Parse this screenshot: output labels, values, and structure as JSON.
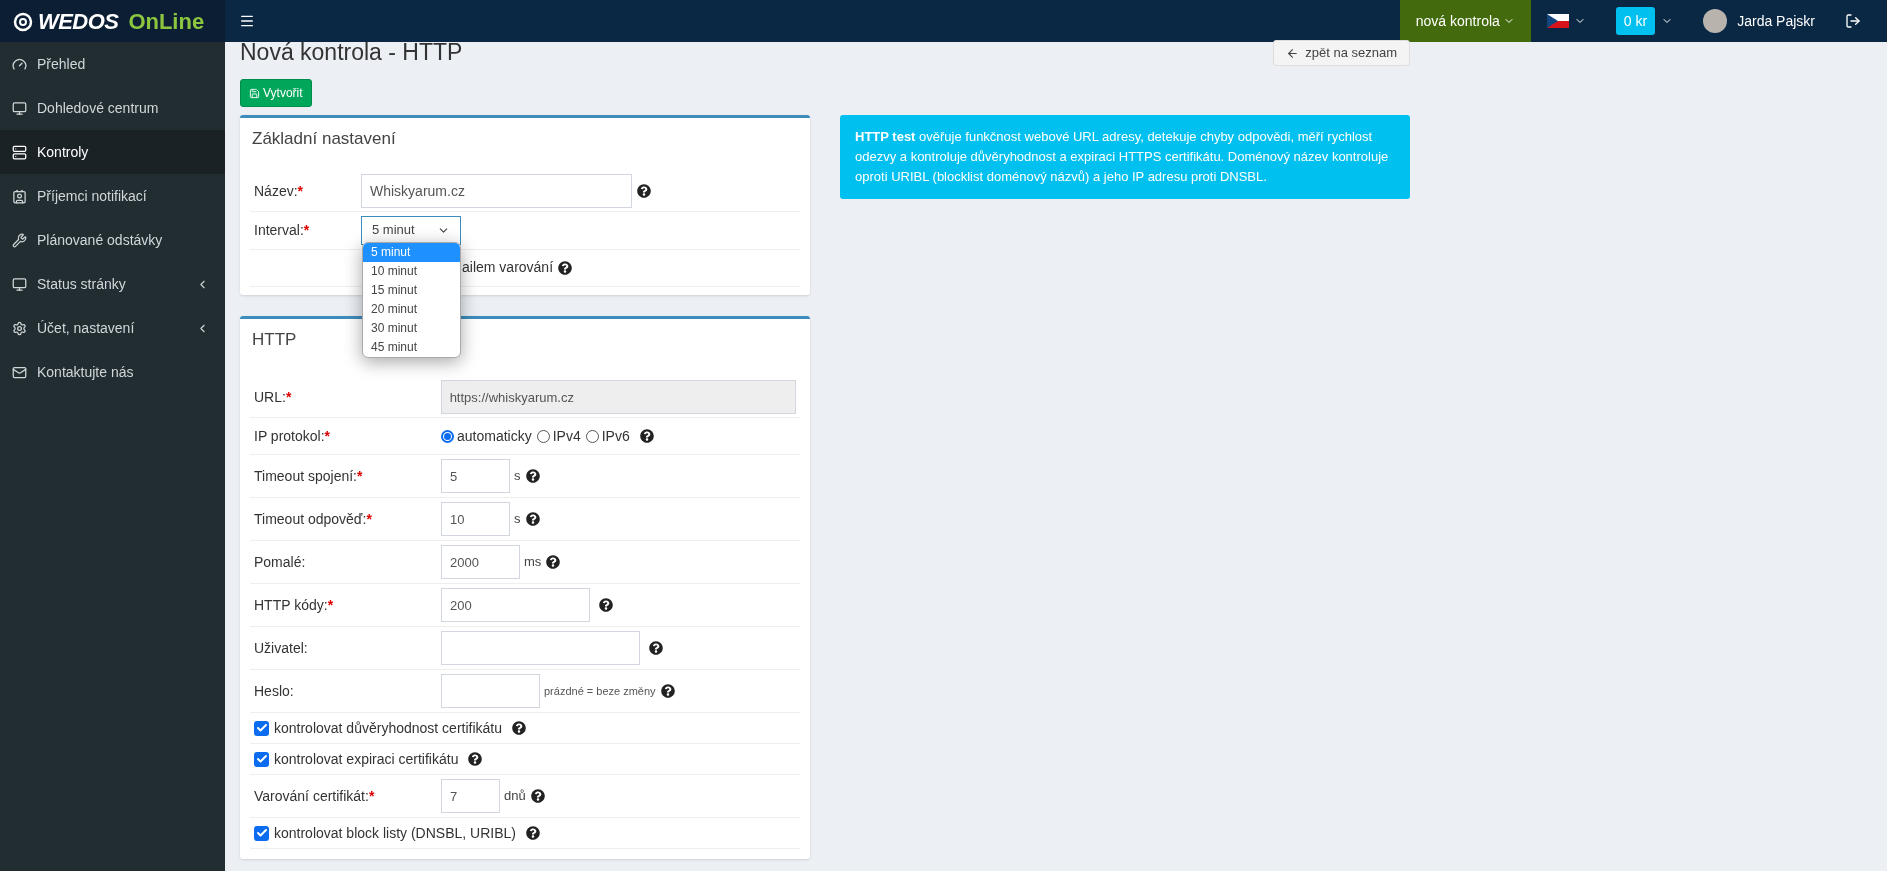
{
  "header": {
    "logo": {
      "brand": "WEDOS",
      "product": "OnLine"
    },
    "new_check_button": "nová kontrola",
    "credit": "0 kr",
    "user": "Jarda Pajskr"
  },
  "sidebar": {
    "items": [
      {
        "label": "Přehled",
        "selected": false,
        "submenu": false
      },
      {
        "label": "Dohledové centrum",
        "selected": false,
        "submenu": false
      },
      {
        "label": "Kontroly",
        "selected": true,
        "submenu": false
      },
      {
        "label": "Příjemci notifikací",
        "selected": false,
        "submenu": false
      },
      {
        "label": "Plánované odstávky",
        "selected": false,
        "submenu": false
      },
      {
        "label": "Status stránky",
        "selected": false,
        "submenu": true
      },
      {
        "label": "Účet, nastavení",
        "selected": false,
        "submenu": true
      },
      {
        "label": "Kontaktujte nás",
        "selected": false,
        "submenu": false
      }
    ]
  },
  "page": {
    "title": "Nová kontrola - HTTP",
    "back_button": "zpět na seznam",
    "create_button": "Vytvořit"
  },
  "basic_settings": {
    "title": "Základní nastavení",
    "name": {
      "label": "Název:",
      "required_mark": "*",
      "value": "Whiskyarum.cz",
      "help": true
    },
    "interval": {
      "label": "Interval:",
      "required_mark": "*",
      "value": "5 minut",
      "expanded": true,
      "options": [
        {
          "label": "5 minut",
          "selected": true
        },
        {
          "label": "10 minut",
          "selected": false
        },
        {
          "label": "15 minut",
          "selected": false
        },
        {
          "label": "20 minut",
          "selected": false
        },
        {
          "label": "30 minut",
          "selected": false
        },
        {
          "label": "45 minut",
          "selected": false
        }
      ]
    },
    "partial_row": {
      "text": "ailem varování",
      "help": true
    }
  },
  "http": {
    "title": "HTTP",
    "rows": [
      {
        "kind": "input",
        "label": "URL:",
        "required_mark": "*",
        "value": "https://whiskyarum.cz",
        "readonly": true,
        "help": false
      },
      {
        "kind": "radio",
        "label": "IP protokol:",
        "required_mark": "*",
        "help": true,
        "options": [
          {
            "label": "automaticky",
            "selected": true
          },
          {
            "label": "IPv4",
            "selected": false
          },
          {
            "label": "IPv6",
            "selected": false
          }
        ]
      },
      {
        "kind": "input",
        "label": "Timeout spojení:",
        "required_mark": "*",
        "value": "5",
        "unit": "s",
        "readonly": false,
        "help": true
      },
      {
        "kind": "input",
        "label": "Timeout odpověď:",
        "required_mark": "*",
        "value": "10",
        "unit": "s",
        "readonly": false,
        "help": true
      },
      {
        "kind": "input",
        "label": "Pomalé:",
        "value": "2000",
        "unit": "ms",
        "readonly": false,
        "help": true
      },
      {
        "kind": "input",
        "label": "HTTP kódy:",
        "required_mark": "*",
        "value": "200",
        "readonly": false,
        "help": true
      },
      {
        "kind": "input",
        "label": "Uživatel:",
        "readonly": false,
        "help": true
      },
      {
        "kind": "input",
        "label": "Heslo:",
        "readonly": false,
        "hint": "prázdné = beze změny",
        "help": true
      },
      {
        "kind": "checkbox",
        "label": "kontrolovat důvěryhodnost certifikátu",
        "checked": true,
        "help": true
      },
      {
        "kind": "checkbox",
        "label": "kontrolovat expiraci certifikátu",
        "checked": true,
        "help": true
      },
      {
        "kind": "input",
        "label": "Varování certifikát:",
        "required_mark": "*",
        "value": "7",
        "unit": "dnů",
        "readonly": false,
        "help": true
      },
      {
        "kind": "checkbox",
        "label": "kontrolovat block listy (DNSBL, URIBL)",
        "checked": true,
        "help": true
      }
    ]
  },
  "info": {
    "text": "**HTTP test** ověřuje funkčnost webové URL adresy, detekuje chyby odpovědi, měří rychlost odezvy a kontroluje důvěryhodnost a expiraci HTTPS certifikátu. Doménový název kontroluje oproti URIBL (blocklist doménový názvů) a jeho IP adresu proti DNSBL."
  }
}
